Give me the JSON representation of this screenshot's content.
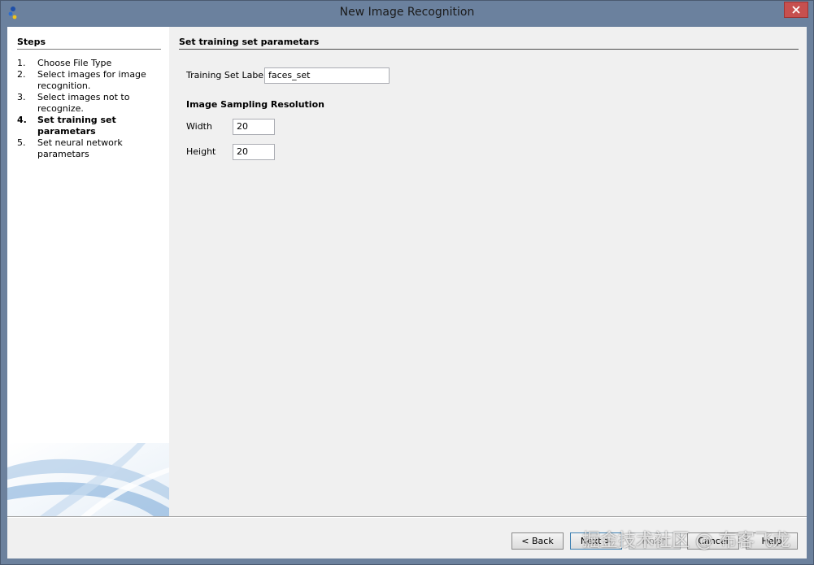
{
  "window": {
    "title": "New Image Recognition",
    "close_label": "×"
  },
  "steps": {
    "title": "Steps",
    "items": [
      {
        "num": "1.",
        "label": "Choose File Type",
        "active": false
      },
      {
        "num": "2.",
        "label": "Select images for image recognition.",
        "active": false
      },
      {
        "num": "3.",
        "label": "Select images not to recognize.",
        "active": false
      },
      {
        "num": "4.",
        "label": "Set training set parametars",
        "active": true
      },
      {
        "num": "5.",
        "label": "Set neural network parametars",
        "active": false
      }
    ]
  },
  "content": {
    "title": "Set training set parametars",
    "training_label": {
      "label": "Training Set Label",
      "value": "faces_set"
    },
    "sampling": {
      "heading": "Image Sampling Resolution",
      "width": {
        "label": "Width",
        "value": "20"
      },
      "height": {
        "label": "Height",
        "value": "20"
      }
    }
  },
  "buttons": {
    "back": "< Back",
    "next": "Next >",
    "finish": "Finish",
    "cancel": "Cancel",
    "help": "Help"
  },
  "watermark": "掘金技术社区 @ 布客飞龙",
  "colors": {
    "titlebar": "#6b819e",
    "close": "#c7504f",
    "panel": "#f0f0f0"
  }
}
